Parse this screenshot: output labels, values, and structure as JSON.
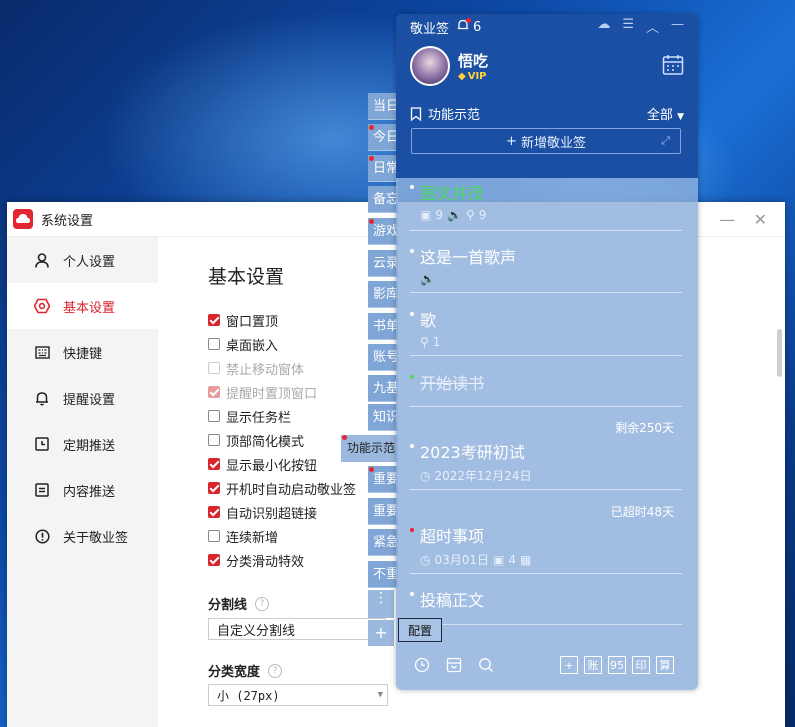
{
  "settings": {
    "title": "系统设置",
    "sidebar": [
      {
        "label": "个人设置",
        "icon": "user-icon"
      },
      {
        "label": "基本设置",
        "icon": "settings-hex-icon"
      },
      {
        "label": "快捷键",
        "icon": "keyboard-icon"
      },
      {
        "label": "提醒设置",
        "icon": "bell-icon"
      },
      {
        "label": "定期推送",
        "icon": "schedule-icon"
      },
      {
        "label": "内容推送",
        "icon": "document-icon"
      },
      {
        "label": "关于敬业签",
        "icon": "info-icon"
      }
    ],
    "active_index": 1,
    "section_title": "基本设置",
    "options": [
      {
        "label": "窗口置顶",
        "checked": true,
        "disabled": false
      },
      {
        "label": "桌面嵌入",
        "checked": false,
        "disabled": false
      },
      {
        "label": "禁止移动窗体",
        "checked": false,
        "disabled": true
      },
      {
        "label": "提醒时置顶窗口",
        "checked": true,
        "disabled": true
      },
      {
        "label": "显示任务栏",
        "checked": false,
        "disabled": false
      },
      {
        "label": "顶部简化模式",
        "checked": false,
        "disabled": false
      },
      {
        "label": "显示最小化按钮",
        "checked": true,
        "disabled": false
      },
      {
        "label": "开机时自动启动敬业签",
        "checked": true,
        "disabled": false
      },
      {
        "label": "自动识别超链接",
        "checked": true,
        "disabled": false
      },
      {
        "label": "连续新增",
        "checked": false,
        "disabled": false
      },
      {
        "label": "分类滑动特效",
        "checked": true,
        "disabled": false
      }
    ],
    "divider_label": "分割线",
    "divider_value": "自定义分割线",
    "category_width_label": "分类宽度",
    "category_width_value": "小 (27px)"
  },
  "tabs": [
    {
      "label": "当日",
      "dot": false
    },
    {
      "label": "今日",
      "dot": true
    },
    {
      "label": "日常",
      "dot": true
    },
    {
      "label": "备忘",
      "dot": false
    },
    {
      "label": "游戏",
      "dot": true
    },
    {
      "label": "云录",
      "dot": false
    },
    {
      "label": "影库",
      "dot": false
    },
    {
      "label": "书单",
      "dot": false
    },
    {
      "label": "账号",
      "dot": false
    },
    {
      "label": "九基",
      "dot": false
    },
    {
      "label": "知识",
      "dot": false
    },
    {
      "label": "重要",
      "dot": true
    },
    {
      "label": "重要",
      "dot": false
    },
    {
      "label": "紧急",
      "dot": false
    },
    {
      "label": "不重",
      "dot": false
    }
  ],
  "active_tab": "功能示范",
  "panel": {
    "app_name": "敬业签",
    "notify_count": "6",
    "user_name": "悟吃",
    "vip": "VIP",
    "category": "功能示范",
    "filter": "全部",
    "new_note": "新增敬业签",
    "config": "配置",
    "notes": [
      {
        "title": "图文并茂",
        "color": "#4cd964",
        "meta": [
          "9",
          "9"
        ],
        "strike": false
      },
      {
        "title": "这是一首歌声",
        "color": "#ffffff",
        "meta": [],
        "strike": false
      },
      {
        "title": "歌",
        "color": "#ffffff",
        "meta": [
          "1"
        ],
        "strike": false
      },
      {
        "title": "开始读书",
        "color": "#e8eefb",
        "meta": [],
        "strike": true
      },
      {
        "title": "2023考研初试",
        "color": "#ffffff",
        "remain": "剩余250天",
        "date": "2022年12月24日"
      },
      {
        "title": "超时事项",
        "color": "#ffffff",
        "remain": "已超时48天",
        "date": "03月01日",
        "count": "4"
      },
      {
        "title": "投稿正文",
        "color": "#ffffff"
      }
    ],
    "bottom_boxes": [
      "+",
      "账",
      "95",
      "印",
      "算"
    ]
  },
  "colors": {
    "accent": "#d9252c",
    "panel_header": "#1a4fa3",
    "green": "#4cd964"
  }
}
